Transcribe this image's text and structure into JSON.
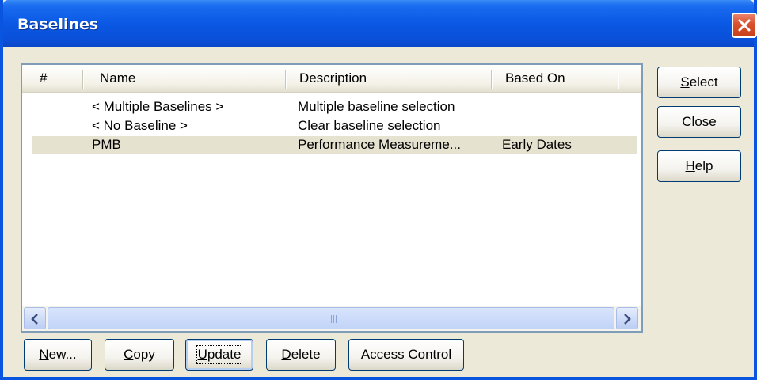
{
  "window": {
    "title": "Baselines"
  },
  "columns": [
    "#",
    "Name",
    "Description",
    "Based On"
  ],
  "rows": [
    {
      "num": "",
      "name": "< Multiple Baselines >",
      "description": "Multiple baseline selection",
      "based_on": "",
      "selected": false
    },
    {
      "num": "",
      "name": "< No Baseline >",
      "description": "Clear baseline selection",
      "based_on": "",
      "selected": false
    },
    {
      "num": "",
      "name": "PMB",
      "description": "Performance Measureme...",
      "based_on": "Early Dates",
      "selected": true
    }
  ],
  "side_buttons": {
    "select": {
      "mnemonic": "S",
      "rest": "elect"
    },
    "close": {
      "pre": "C",
      "mnemonic": "l",
      "rest": "ose"
    },
    "help": {
      "mnemonic": "H",
      "rest": "elp"
    }
  },
  "bottom_buttons": {
    "new": {
      "mnemonic": "N",
      "rest": "ew..."
    },
    "copy": {
      "mnemonic": "C",
      "rest": "opy"
    },
    "update": {
      "mnemonic": "U",
      "rest": "pdate"
    },
    "delete": {
      "mnemonic": "D",
      "rest": "elete"
    },
    "access": {
      "label": "Access Control"
    }
  },
  "icons": {
    "close": "close-x-icon",
    "scroll_left": "arrow-left-icon",
    "scroll_right": "arrow-right-icon"
  },
  "colors": {
    "title_bar": "#0a58e4",
    "selected_row": "#e6e2d0",
    "dialog_bg": "#ece9d8"
  }
}
